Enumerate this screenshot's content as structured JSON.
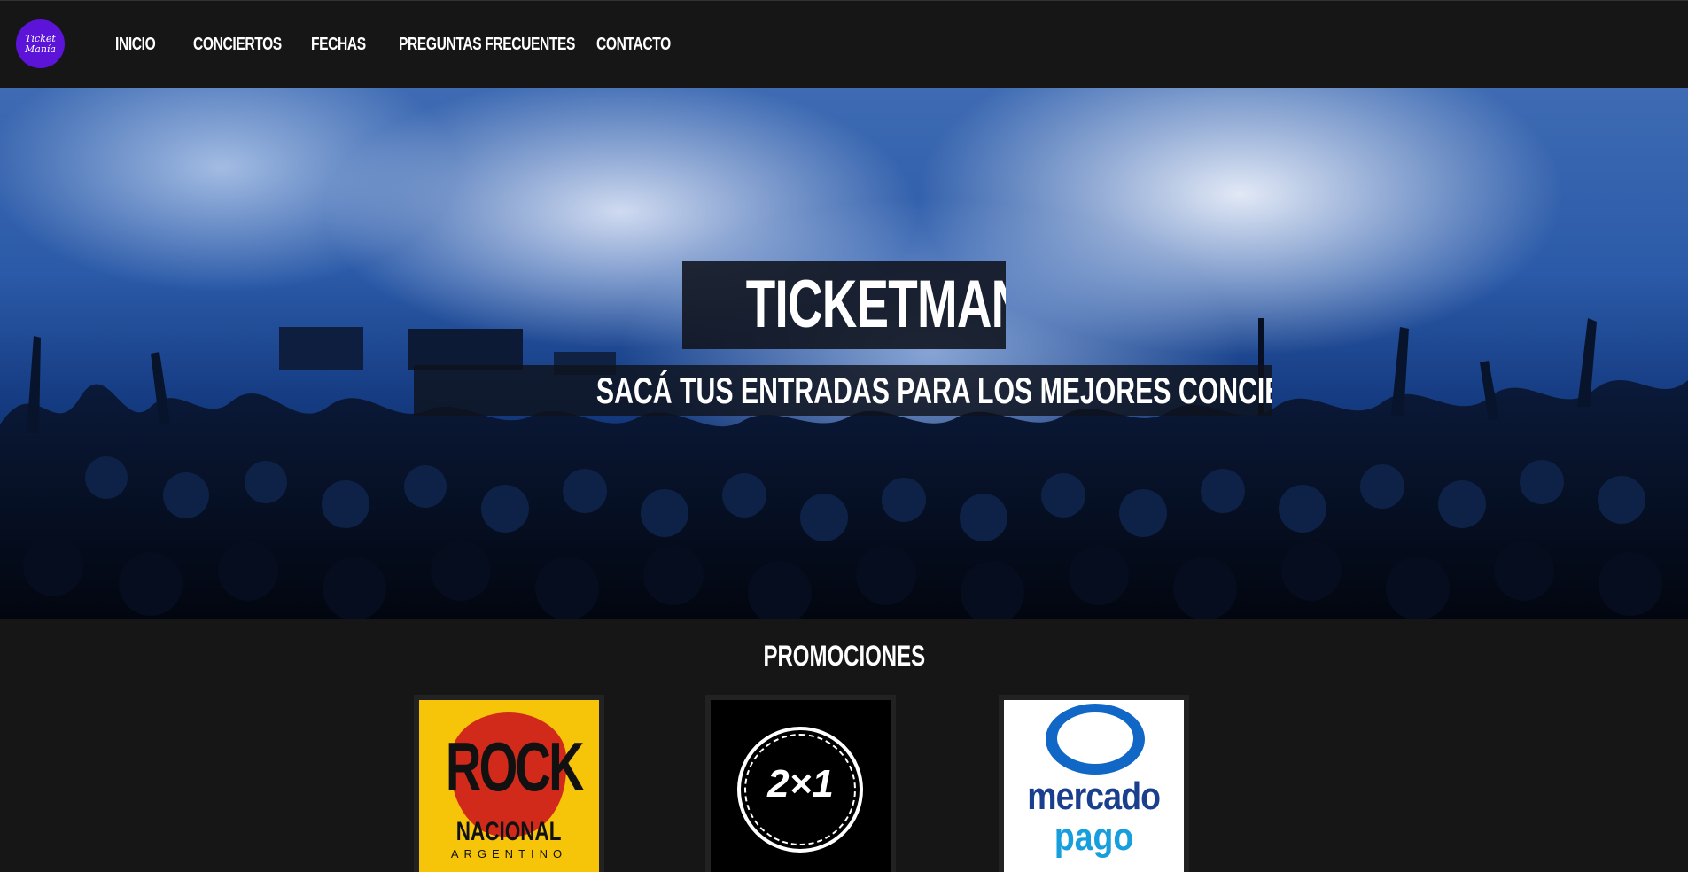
{
  "brand": {
    "logo_line1": "Ticket",
    "logo_line2": "Manía"
  },
  "nav": {
    "items": [
      "INICIO",
      "CONCIERTOS",
      "FECHAS",
      "PREGUNTAS FRECUENTES",
      "CONTACTO"
    ]
  },
  "hero": {
    "title": "TICKETMANÍA",
    "subtitle": "SACÁ TUS ENTRADAS PARA LOS MEJORES CONCIERTOS DEL MUNDO!"
  },
  "promos": {
    "title": "PROMOCIONES",
    "items": [
      {
        "line1": "ROCK",
        "line2": "NACIONAL",
        "line3": "ARGENTINO"
      },
      {
        "line1": "2×1"
      },
      {
        "line1": "mercado",
        "line2": "pago"
      }
    ]
  },
  "colors": {
    "page_bg": "#161616",
    "logo_bg": "#5b14d8",
    "rock_yellow": "#f6c409",
    "mp_blue": "#1a3f8e",
    "mp_lightblue": "#169fdc"
  }
}
